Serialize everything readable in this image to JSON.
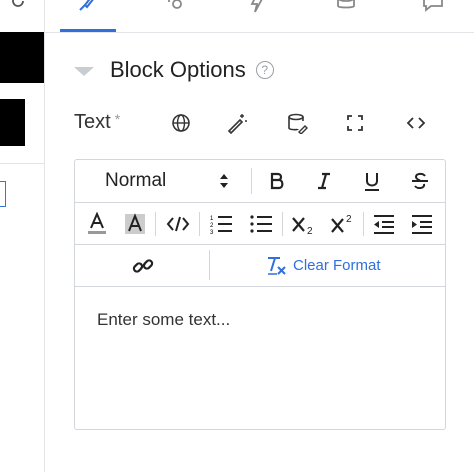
{
  "panel": {
    "section_title": "Block Options",
    "field_label": "Text",
    "required_mark": "*"
  },
  "editor": {
    "heading_value": "Normal",
    "clear_format_label": "Clear Format",
    "content": "Enter some text...",
    "accent_color": "#2f6fde"
  },
  "tabs": [
    {
      "icon": "brush-icon",
      "active": true
    },
    {
      "icon": "nodes-icon",
      "active": false
    },
    {
      "icon": "bolt-icon",
      "active": false
    },
    {
      "icon": "database-icon",
      "active": false
    },
    {
      "icon": "comment-icon",
      "active": false
    }
  ]
}
